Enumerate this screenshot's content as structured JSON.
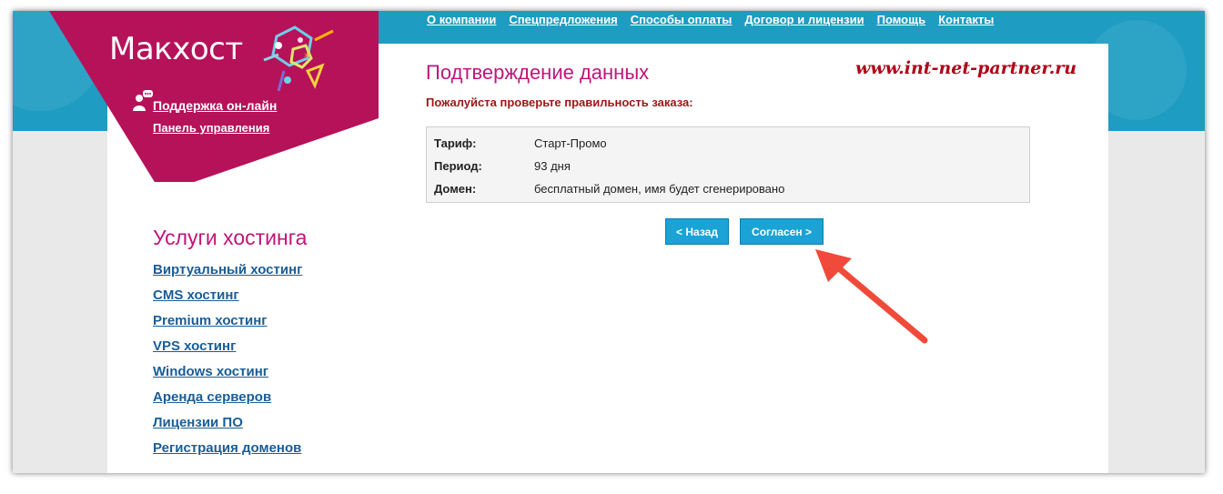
{
  "header": {
    "nav": [
      {
        "label": "О компании"
      },
      {
        "label": "Спецпредложения"
      },
      {
        "label": "Способы оплаты"
      },
      {
        "label": "Договор и лицензии"
      },
      {
        "label": "Помощь"
      },
      {
        "label": "Контакты"
      }
    ]
  },
  "brand": {
    "logo": "Макхост",
    "support_link": "Поддержка он-лайн",
    "panel_link": "Панель управления"
  },
  "sidebar": {
    "title": "Услуги хостинга",
    "items": [
      {
        "label": "Виртуальный хостинг"
      },
      {
        "label": "CMS хостинг"
      },
      {
        "label": "Premium хостинг"
      },
      {
        "label": "VPS хостинг"
      },
      {
        "label": "Windows хостинг"
      },
      {
        "label": "Аренда серверов"
      },
      {
        "label": "Лицензии ПО"
      },
      {
        "label": "Регистрация доменов"
      }
    ]
  },
  "main": {
    "title": "Подтверждение данных",
    "watermark": "www.int-net-partner.ru",
    "notice": "Пожалуйста проверьте правильность заказа:",
    "order": [
      {
        "label": "Тариф:",
        "value": "Старт-Промо"
      },
      {
        "label": "Период:",
        "value": "93 дня"
      },
      {
        "label": "Домен:",
        "value": "бесплатный домен, имя будет сгенерировано"
      }
    ],
    "buttons": {
      "back": "< Назад",
      "agree": "Согласен >"
    }
  },
  "colors": {
    "brand": "#b5125a",
    "accent": "#1aa3d4",
    "title": "#c0147a",
    "link": "#1a5d96",
    "annotation_arrow": "#f04a3a"
  }
}
